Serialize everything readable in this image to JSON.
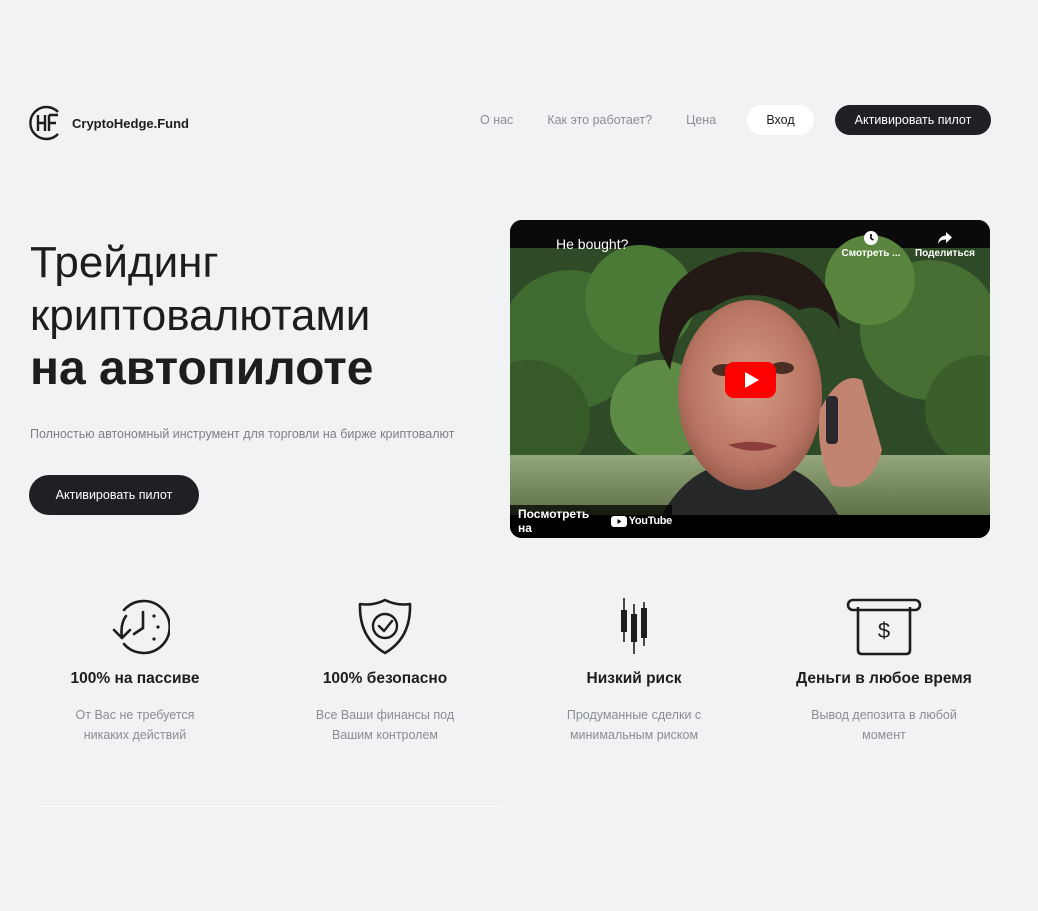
{
  "brand": {
    "name": "CryptoHedge.Fund",
    "mark": "HF"
  },
  "nav": {
    "items": [
      "О нас",
      "Как это работает?",
      "Цена"
    ],
    "login_label": "Вход",
    "activate_label": "Активировать пилот"
  },
  "hero": {
    "title_line1": "Трейдинг",
    "title_line2": "криптовалютами",
    "title_line3": "на автопилоте",
    "subtitle": "Полностью автономный инструмент для торговли на бирже криптовалют",
    "cta_label": "Активировать пилот"
  },
  "video": {
    "title": "He bought?",
    "watch_later_label": "Смотреть ...",
    "share_label": "Поделиться",
    "watch_on_label": "Посмотреть на",
    "youtube_label": "YouTube"
  },
  "features": [
    {
      "icon": "clock-history-icon",
      "title": "100% на пассиве",
      "description": "От Вас не требуется никаких действий"
    },
    {
      "icon": "shield-check-icon",
      "title": "100% безопасно",
      "description": "Все Ваши финансы под Вашим контролем"
    },
    {
      "icon": "candlestick-icon",
      "title": "Низкий риск",
      "description": "Продуманные сделки с минимальным риском"
    },
    {
      "icon": "cash-withdraw-icon",
      "title": "Деньги в любое время",
      "description": "Вывод депозита в любой момент"
    }
  ],
  "colors": {
    "background": "#f1f2f4",
    "primary_dark": "#1f2024",
    "muted_text": "#8a8d93",
    "youtube_red": "#ff0000"
  }
}
